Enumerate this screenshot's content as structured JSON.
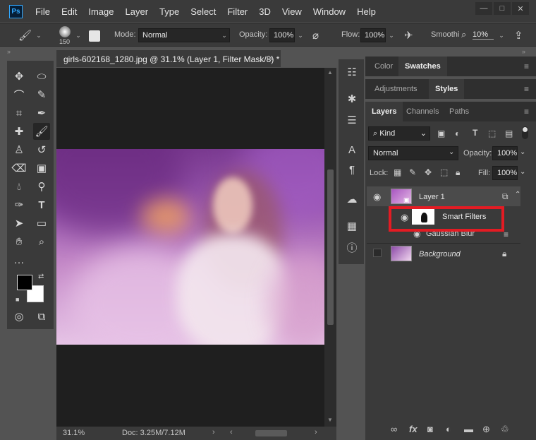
{
  "app": {
    "logo": "Ps"
  },
  "menu": [
    "File",
    "Edit",
    "Image",
    "Layer",
    "Type",
    "Select",
    "Filter",
    "3D",
    "View",
    "Window",
    "Help"
  ],
  "window_controls": [
    "—",
    "□",
    "✕"
  ],
  "options": {
    "brush_size": "150",
    "mode_label": "Mode:",
    "mode_value": "Normal",
    "opacity_label": "Opacity:",
    "opacity_value": "100%",
    "flow_label": "Flow:",
    "flow_value": "100%",
    "smoothing_label": "Smoothi",
    "smoothing_value": "10%"
  },
  "document": {
    "tab_title": "girls-602168_1280.jpg @ 31.1% (Layer 1, Filter Mask/8) *",
    "zoom": "31.1%",
    "doc_size": "Doc: 3.25M/7.12M"
  },
  "panels": {
    "top_tabs": [
      "Color",
      "Swatches"
    ],
    "mid_tabs": [
      "Adjustments",
      "Styles"
    ],
    "layer_tabs": [
      "Layers",
      "Channels",
      "Paths"
    ]
  },
  "layers_panel": {
    "kind_label": "Kind",
    "blend_mode": "Normal",
    "opacity_label": "Opacity:",
    "opacity_value": "100%",
    "lock_label": "Lock:",
    "fill_label": "Fill:",
    "fill_value": "100%"
  },
  "layers": {
    "layer1": "Layer 1",
    "smart_filters": "Smart Filters",
    "gaussian_blur": "Gaussian Blur",
    "background": "Background"
  },
  "colors": {
    "highlight": "#e31b23",
    "foreground": "#000000",
    "background": "#ffffff"
  },
  "icons": [
    "brush-icon",
    "move-icon",
    "marquee-icon",
    "lasso-icon",
    "quick-select-icon",
    "crop-icon",
    "eyedropper-icon",
    "healing-icon",
    "brush-tool-icon",
    "stamp-icon",
    "history-brush-icon",
    "eraser-icon",
    "gradient-icon",
    "blur-icon",
    "dodge-icon",
    "pen-icon",
    "type-icon",
    "path-select-icon",
    "rectangle-icon",
    "hand-icon",
    "zoom-icon",
    "eye-icon",
    "lock-icon",
    "fx-icon",
    "trash-icon"
  ]
}
